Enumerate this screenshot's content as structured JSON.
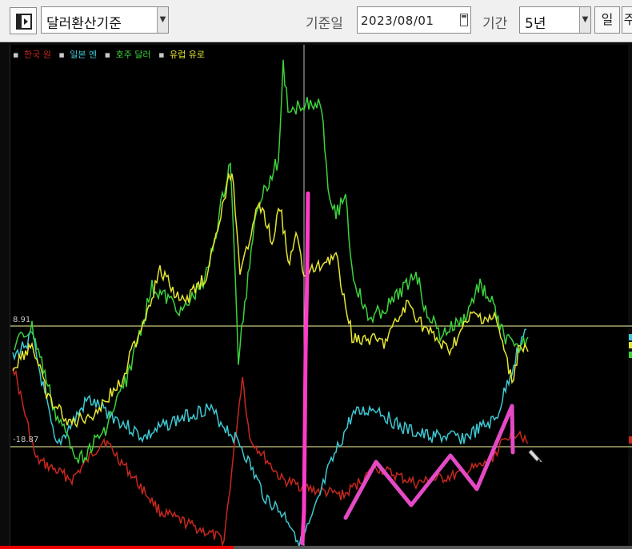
{
  "toolbar": {
    "base_currency": "달러환산기준",
    "date_label": "기준일",
    "date_value": "2023/08/01",
    "period_label": "기간",
    "period_value": "5년",
    "unit_button": "일",
    "next_button": "주"
  },
  "legend": [
    {
      "name": "한국 원",
      "color": "#c8281e"
    },
    {
      "name": "일본 엔",
      "color": "#3ec8d2"
    },
    {
      "name": "호주 달러",
      "color": "#3cd23c"
    },
    {
      "name": "유럽 유로",
      "color": "#e6e632"
    }
  ],
  "reference_lines": [
    {
      "label": "8.91",
      "color": "#a8a86a"
    },
    {
      "label": "-18.87",
      "color": "#a8a86a"
    }
  ],
  "colors": {
    "cursor_line": "#bbbbbb",
    "highlight": "#ff3cc8",
    "chart_background": "#000000"
  },
  "video_progress": 0.37
}
